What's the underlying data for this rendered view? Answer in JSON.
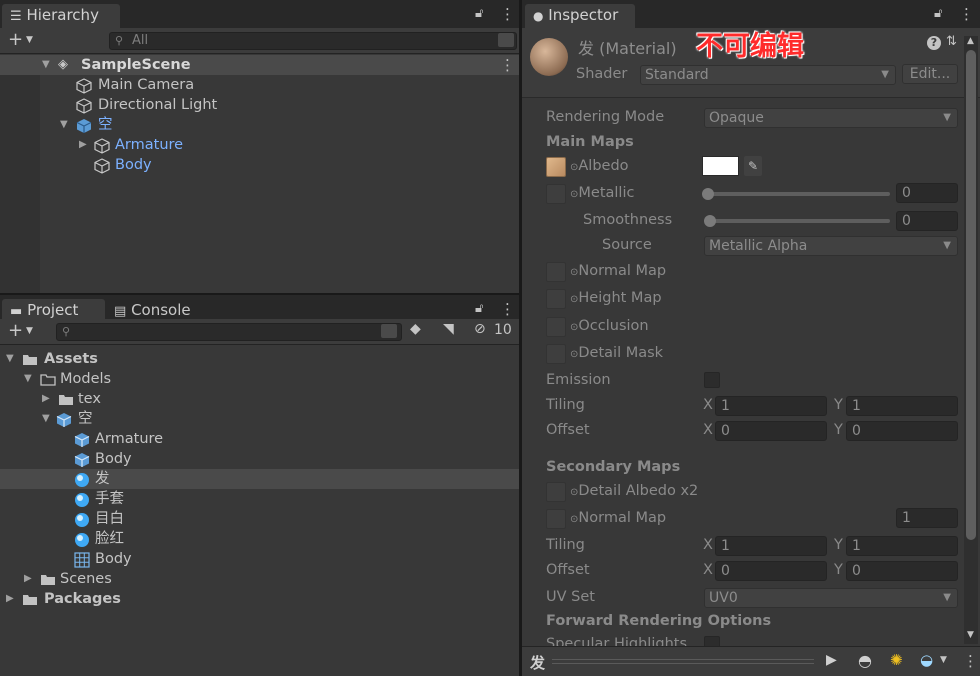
{
  "hierarchy": {
    "tab_label": "Hierarchy",
    "search_placeholder": "All",
    "scene_name": "SampleScene",
    "items": [
      {
        "label": "Main Camera"
      },
      {
        "label": "Directional Light"
      },
      {
        "label": "空"
      },
      {
        "label": "Armature"
      },
      {
        "label": "Body"
      }
    ]
  },
  "project": {
    "tabs": [
      {
        "label": "Project"
      },
      {
        "label": "Console"
      }
    ],
    "hidden_count": "10",
    "tree": [
      {
        "label": "Assets"
      },
      {
        "label": "Models"
      },
      {
        "label": "tex"
      },
      {
        "label": "空"
      },
      {
        "label": "Armature"
      },
      {
        "label": "Body"
      },
      {
        "label": "发"
      },
      {
        "label": "手套"
      },
      {
        "label": "目白"
      },
      {
        "label": "脸红"
      },
      {
        "label": "Body"
      },
      {
        "label": "Scenes"
      },
      {
        "label": "Packages"
      }
    ]
  },
  "inspector": {
    "tab_label": "Inspector",
    "title": "发 (Material)",
    "annotation": "不可编辑",
    "shader_label": "Shader",
    "shader_value": "Standard",
    "edit_button": "Edit...",
    "rendering_mode_label": "Rendering Mode",
    "rendering_mode_value": "Opaque",
    "main_maps_header": "Main Maps",
    "albedo_label": "Albedo",
    "metallic_label": "Metallic",
    "metallic_value": "0",
    "smoothness_label": "Smoothness",
    "smoothness_value": "0",
    "source_label": "Source",
    "source_value": "Metallic Alpha",
    "normal_map_label": "Normal Map",
    "height_map_label": "Height Map",
    "occlusion_label": "Occlusion",
    "detail_mask_label": "Detail Mask",
    "emission_label": "Emission",
    "tiling_label": "Tiling",
    "offset_label": "Offset",
    "x_label": "X",
    "y_label": "Y",
    "main_tiling": {
      "x": "1",
      "y": "1"
    },
    "main_offset": {
      "x": "0",
      "y": "0"
    },
    "secondary_maps_header": "Secondary Maps",
    "detail_albedo_label": "Detail Albedo x2",
    "secondary_normal_label": "Normal Map",
    "secondary_normal_value": "1",
    "sec_tiling": {
      "x": "1",
      "y": "1"
    },
    "sec_offset": {
      "x": "0",
      "y": "0"
    },
    "uv_set_label": "UV Set",
    "uv_set_value": "UV0",
    "forward_header": "Forward Rendering Options",
    "specular_label": "Specular Highlights",
    "preview_name": "发",
    "colors": {
      "accent": "#2c5d87",
      "annotation": "#ff2b2b",
      "blue_text": "#7cb1ff"
    }
  }
}
